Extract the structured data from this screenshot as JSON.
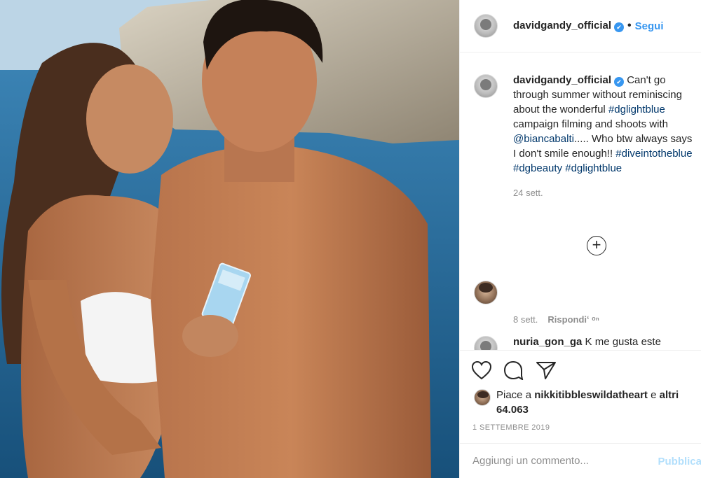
{
  "post": {
    "username": "davidgandy_official",
    "verified_glyph": "✔",
    "separator": "•",
    "follow_label": "Segui"
  },
  "caption": {
    "username": "davidgandy_official",
    "text_1": "Can't go through summer without reminiscing about the wonderful ",
    "tag_1": "#dglightblue",
    "text_2": " campaign filming and shoots with ",
    "mention": "@biancabalti",
    "text_3": "..... Who btw always says I don't smile enough!! ",
    "tag_2": "#diveintotheblue",
    "tag_3": "#dgbeauty",
    "tag_4": "#dglightblue",
    "age": "24 sett."
  },
  "load_more": {
    "glyph": "+"
  },
  "comment_2": {
    "age": "8 sett.",
    "reply_label": "Rispondi",
    "extra": "ʻ ᵒⁿ"
  },
  "comment_3": {
    "username": "nuria_gon_ga",
    "text": "K me gusta este"
  },
  "actions": {
    "like_icon": "heart-icon",
    "comment_icon": "comment-icon",
    "share_icon": "paper-plane-icon"
  },
  "likes": {
    "prefix": "Piace a ",
    "user": "nikkitibbleswildatheart",
    "suffix_1": " e ",
    "others": "altri 64.063"
  },
  "date": "1 SETTEMBRE 2019",
  "add_comment": {
    "placeholder": "Aggiungi un commento...",
    "publish_label": "Pubblica"
  },
  "colors": {
    "link": "#3897f0",
    "tag": "#00376b",
    "muted": "#8e8e8e",
    "publish_disabled": "#b2dffc"
  }
}
